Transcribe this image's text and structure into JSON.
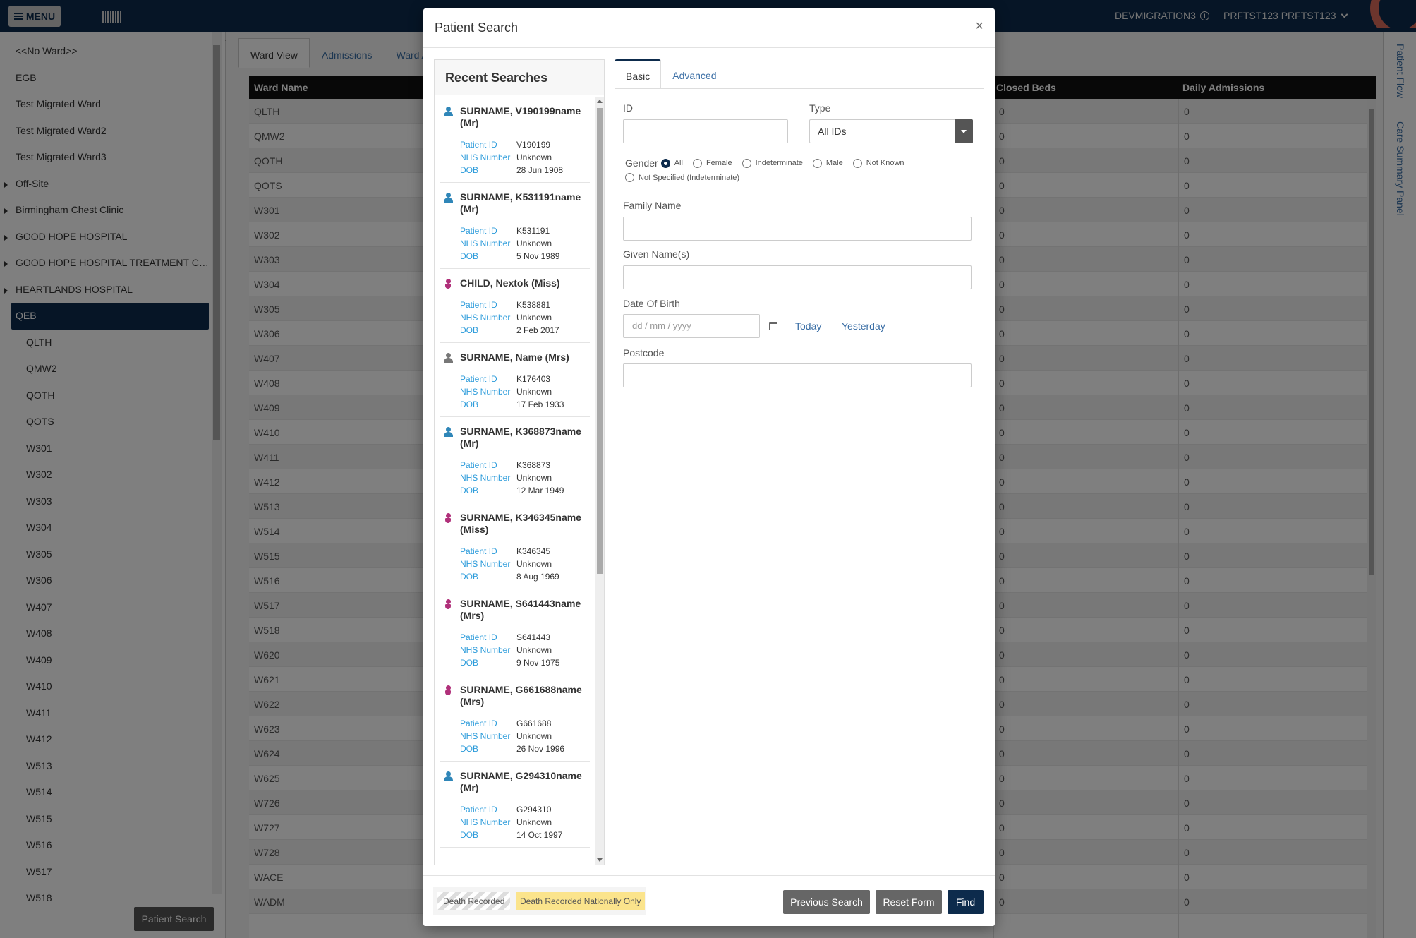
{
  "topbar": {
    "menu_label": "MENU",
    "environment": "DEVMIGRATION3",
    "user": "PRFTST123 PRFTST123"
  },
  "sidebar": {
    "items": [
      {
        "label": "<<No Ward>>",
        "level": 0,
        "expandable": false
      },
      {
        "label": "EGB",
        "level": 0,
        "expandable": false
      },
      {
        "label": "Test Migrated Ward",
        "level": 0,
        "expandable": false
      },
      {
        "label": "Test Migrated Ward2",
        "level": 0,
        "expandable": false
      },
      {
        "label": "Test Migrated Ward3",
        "level": 0,
        "expandable": false
      },
      {
        "label": "Off-Site",
        "level": 0,
        "expandable": true
      },
      {
        "label": "Birmingham Chest Clinic",
        "level": 0,
        "expandable": true
      },
      {
        "label": "GOOD HOPE HOSPITAL",
        "level": 0,
        "expandable": true
      },
      {
        "label": "GOOD HOPE HOSPITAL TREATMENT CE...",
        "level": 0,
        "expandable": true
      },
      {
        "label": "HEARTLANDS HOSPITAL",
        "level": 0,
        "expandable": true
      },
      {
        "label": "QEB",
        "level": 0,
        "expandable": true,
        "selected": true
      },
      {
        "label": "QLTH",
        "level": 1
      },
      {
        "label": "QMW2",
        "level": 1
      },
      {
        "label": "QOTH",
        "level": 1
      },
      {
        "label": "QOTS",
        "level": 1
      },
      {
        "label": "W301",
        "level": 1
      },
      {
        "label": "W302",
        "level": 1
      },
      {
        "label": "W303",
        "level": 1
      },
      {
        "label": "W304",
        "level": 1
      },
      {
        "label": "W305",
        "level": 1
      },
      {
        "label": "W306",
        "level": 1
      },
      {
        "label": "W407",
        "level": 1
      },
      {
        "label": "W408",
        "level": 1
      },
      {
        "label": "W409",
        "level": 1
      },
      {
        "label": "W410",
        "level": 1
      },
      {
        "label": "W411",
        "level": 1
      },
      {
        "label": "W412",
        "level": 1
      },
      {
        "label": "W513",
        "level": 1
      },
      {
        "label": "W514",
        "level": 1
      },
      {
        "label": "W515",
        "level": 1
      },
      {
        "label": "W516",
        "level": 1
      },
      {
        "label": "W517",
        "level": 1
      },
      {
        "label": "W518",
        "level": 1
      }
    ],
    "footer_button": "Patient Search"
  },
  "main": {
    "tabs": [
      "Ward View",
      "Admissions",
      "Ward A"
    ],
    "table": {
      "headers": [
        "Ward Name",
        "Closed Beds",
        "Daily Admissions"
      ],
      "rows": [
        [
          "QLTH",
          "0",
          "0"
        ],
        [
          "QMW2",
          "0",
          "0"
        ],
        [
          "QOTH",
          "0",
          "0"
        ],
        [
          "QOTS",
          "0",
          "0"
        ],
        [
          "W301",
          "0",
          "0"
        ],
        [
          "W302",
          "0",
          "0"
        ],
        [
          "W303",
          "0",
          "0"
        ],
        [
          "W304",
          "0",
          "0"
        ],
        [
          "W305",
          "0",
          "0"
        ],
        [
          "W306",
          "0",
          "0"
        ],
        [
          "W407",
          "0",
          "0"
        ],
        [
          "W408",
          "0",
          "0"
        ],
        [
          "W409",
          "0",
          "0"
        ],
        [
          "W410",
          "0",
          "0"
        ],
        [
          "W411",
          "0",
          "0"
        ],
        [
          "W412",
          "0",
          "0"
        ],
        [
          "W513",
          "0",
          "0"
        ],
        [
          "W514",
          "0",
          "0"
        ],
        [
          "W515",
          "0",
          "0"
        ],
        [
          "W516",
          "0",
          "0"
        ],
        [
          "W517",
          "0",
          "0"
        ],
        [
          "W518",
          "0",
          "0"
        ],
        [
          "W620",
          "0",
          "0"
        ],
        [
          "W621",
          "0",
          "0"
        ],
        [
          "W622",
          "0",
          "0"
        ],
        [
          "W623",
          "0",
          "0"
        ],
        [
          "W624",
          "0",
          "0"
        ],
        [
          "W625",
          "0",
          "0"
        ],
        [
          "W726",
          "0",
          "0"
        ],
        [
          "W727",
          "0",
          "0"
        ],
        [
          "W728",
          "0",
          "0"
        ],
        [
          "WACE",
          "0",
          "0"
        ],
        [
          "WADM",
          "0",
          "0"
        ]
      ]
    }
  },
  "right_rail": [
    "Patient Flow",
    "Care Summary Panel"
  ],
  "modal": {
    "title": "Patient Search",
    "close": "×",
    "recent_title": "Recent Searches",
    "field_keys": {
      "id": "Patient ID",
      "nhs": "NHS Number",
      "dob": "DOB"
    },
    "recent": [
      {
        "name": "SURNAME, V190199name (Mr)",
        "gender": "male",
        "patient_id": "V190199",
        "nhs": "Unknown",
        "dob": "28 Jun 1908"
      },
      {
        "name": "SURNAME, K531191name (Mr)",
        "gender": "male",
        "patient_id": "K531191",
        "nhs": "Unknown",
        "dob": "5 Nov 1989"
      },
      {
        "name": "CHILD, Nextok (Miss)",
        "gender": "female",
        "patient_id": "K538881",
        "nhs": "Unknown",
        "dob": "2 Feb 2017"
      },
      {
        "name": "SURNAME, Name (Mrs)",
        "gender": "unknown",
        "patient_id": "K176403",
        "nhs": "Unknown",
        "dob": "17 Feb 1933"
      },
      {
        "name": "SURNAME, K368873name (Mr)",
        "gender": "male",
        "patient_id": "K368873",
        "nhs": "Unknown",
        "dob": "12 Mar 1949"
      },
      {
        "name": "SURNAME, K346345name (Miss)",
        "gender": "female",
        "patient_id": "K346345",
        "nhs": "Unknown",
        "dob": "8 Aug 1969"
      },
      {
        "name": "SURNAME, S641443name (Mrs)",
        "gender": "female",
        "patient_id": "S641443",
        "nhs": "Unknown",
        "dob": "9 Nov 1975"
      },
      {
        "name": "SURNAME, G661688name (Mrs)",
        "gender": "female",
        "patient_id": "G661688",
        "nhs": "Unknown",
        "dob": "26 Nov 1996"
      },
      {
        "name": "SURNAME, G294310name (Mr)",
        "gender": "male",
        "patient_id": "G294310",
        "nhs": "Unknown",
        "dob": "14 Oct 1997"
      }
    ],
    "tabs": {
      "basic": "Basic",
      "advanced": "Advanced"
    },
    "form": {
      "id_label": "ID",
      "id_value": "",
      "type_label": "Type",
      "type_value": "All IDs",
      "gender_label": "Gender",
      "gender_options": [
        "All",
        "Female",
        "Indeterminate",
        "Male",
        "Not Known",
        "Not Specified (Indeterminate)"
      ],
      "gender_selected": "All",
      "family_label": "Family Name",
      "given_label": "Given Name(s)",
      "dob_label": "Date Of Birth",
      "dob_placeholder": "dd / mm / yyyy",
      "today": "Today",
      "yesterday": "Yesterday",
      "postcode_label": "Postcode"
    },
    "footer": {
      "legend_death": "Death Recorded",
      "legend_national": "Death Recorded Nationally Only",
      "previous": "Previous Search",
      "reset": "Reset Form",
      "find": "Find"
    }
  }
}
